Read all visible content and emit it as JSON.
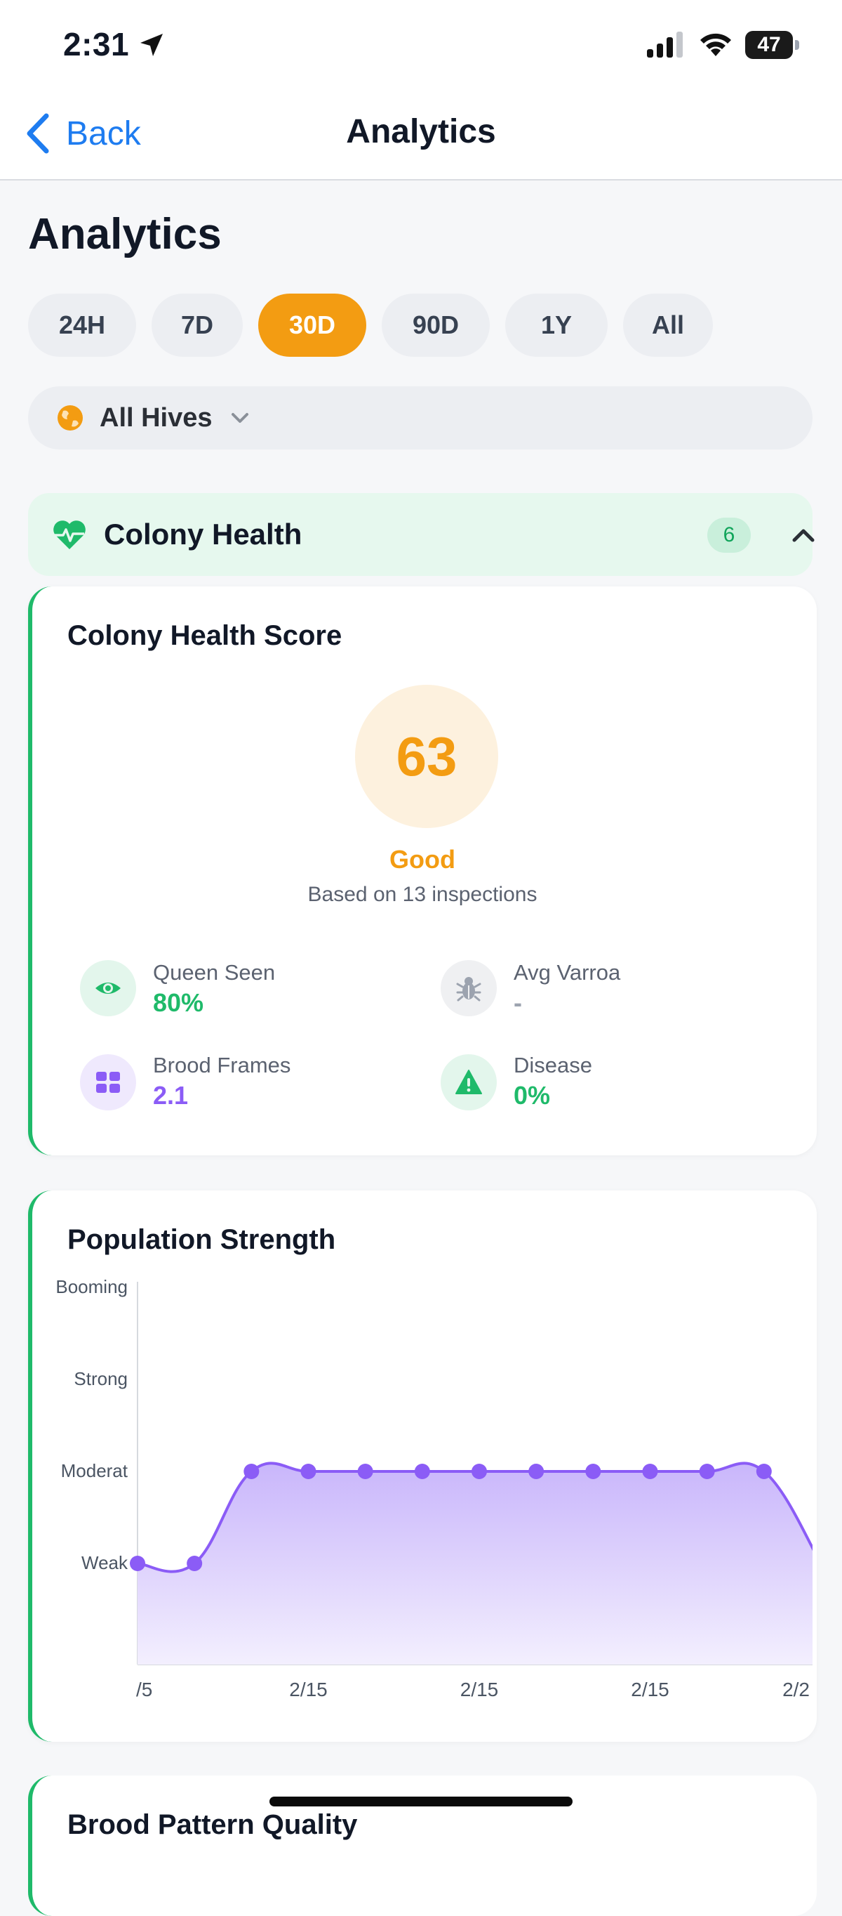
{
  "status_bar": {
    "time": "2:31",
    "battery": "47"
  },
  "nav": {
    "back_label": "Back",
    "title": "Analytics"
  },
  "page": {
    "title": "Analytics"
  },
  "time_ranges": [
    {
      "label": "24H",
      "active": false
    },
    {
      "label": "7D",
      "active": false
    },
    {
      "label": "30D",
      "active": true
    },
    {
      "label": "90D",
      "active": false
    },
    {
      "label": "1Y",
      "active": false
    },
    {
      "label": "All",
      "active": false
    }
  ],
  "hive_selector": {
    "value": "All Hives"
  },
  "section": {
    "label": "Colony Health",
    "count": "6"
  },
  "health_card": {
    "title": "Colony Health Score",
    "score": "63",
    "rating": "Good",
    "basis": "Based on 13 inspections",
    "metrics": [
      {
        "label": "Queen Seen",
        "value": "80%",
        "color": "#1fba6a",
        "icon": "eye-icon"
      },
      {
        "label": "Avg Varroa",
        "value": "-",
        "color": "#9ca3af",
        "icon": "bug-icon"
      },
      {
        "label": "Brood Frames",
        "value": "2.1",
        "color": "#8b5cf6",
        "icon": "grid-icon"
      },
      {
        "label": "Disease",
        "value": "0%",
        "color": "#1fba6a",
        "icon": "warning-icon"
      }
    ]
  },
  "population_card": {
    "title": "Population Strength"
  },
  "next_card": {
    "title": "Brood Pattern Quality"
  },
  "colors": {
    "accent": "#f39c12",
    "green": "#1fba6a",
    "purple": "#8b5cf6",
    "link": "#1e7cf0"
  },
  "chart_data": {
    "type": "area",
    "title": "Population Strength",
    "y_categories": [
      "Weak",
      "Moderat",
      "Strong",
      "Booming"
    ],
    "y_values": [
      1,
      2,
      3,
      4
    ],
    "x_ticks": [
      "/5",
      "2/15",
      "2/15",
      "2/15",
      "2/2"
    ],
    "series": [
      {
        "values": [
          1,
          1,
          2,
          2,
          2,
          2,
          2,
          2,
          2,
          2,
          2,
          2,
          1
        ]
      }
    ],
    "ylim": [
      0,
      4
    ],
    "grid": false
  }
}
